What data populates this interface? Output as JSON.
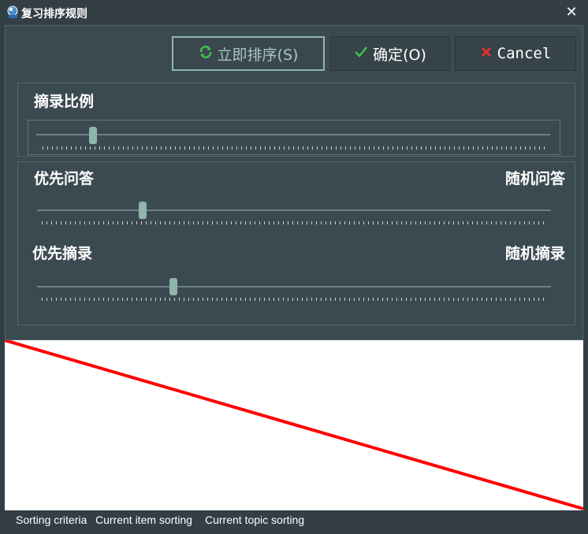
{
  "window": {
    "title": "复习排序规则",
    "close_glyph": "✕"
  },
  "toolbar": {
    "sort_now_label": "立即排序(S)",
    "ok_label": "确定(O)",
    "cancel_label": "Cancel"
  },
  "extract_ratio": {
    "label": "摘录比例",
    "value_fraction": 0.11
  },
  "priority": {
    "qa_left_label": "优先问答",
    "qa_right_label": "随机问答",
    "qa_value_fraction": 0.205,
    "extract_left_label": "优先摘录",
    "extract_right_label": "随机摘录",
    "extract_value_fraction": 0.265
  },
  "statusbar": {
    "tabs": [
      "Sorting criteria",
      "Current item sorting",
      "Current topic sorting"
    ]
  },
  "colors": {
    "accent": "#8fb5ad",
    "canvas_line": "#ff0000",
    "background": "#3b4a51"
  },
  "icons": {
    "sort": "refresh-icon",
    "ok": "check-icon",
    "cancel": "x-icon"
  }
}
